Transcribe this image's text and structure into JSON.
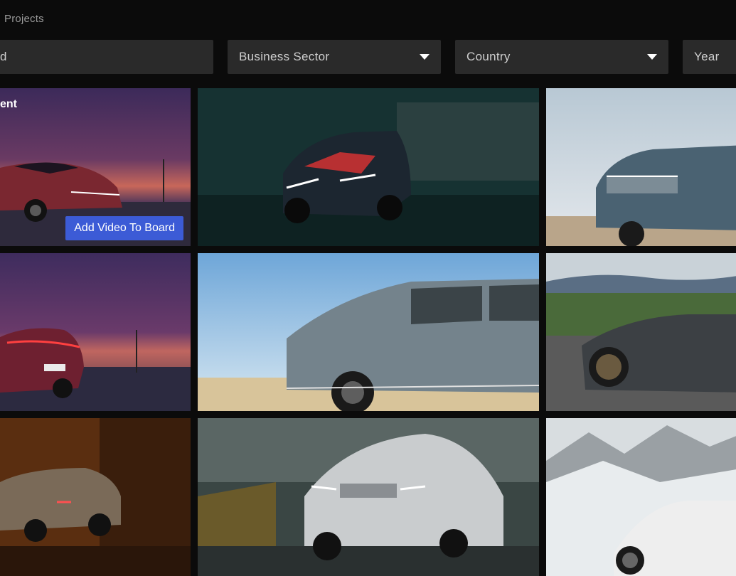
{
  "breadcrumb": {
    "label": "Projects"
  },
  "filters": {
    "search_value": "rd",
    "business_sector": "Business Sector",
    "country": "Country",
    "year": "Year"
  },
  "tiles": [
    {
      "title": "ent",
      "button": "Add Video To Board"
    }
  ],
  "colors": {
    "accent": "#3c5bd6",
    "background": "#0b0b0b",
    "filter_bg": "#2a2a2a"
  }
}
